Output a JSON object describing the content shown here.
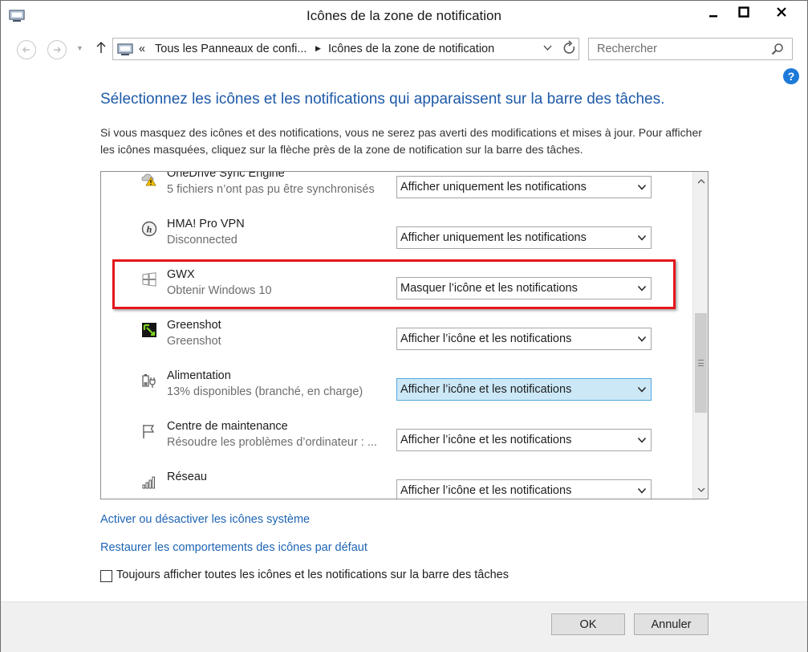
{
  "window": {
    "title": "Icônes de la zone de notification",
    "controls": {
      "minimize": "—",
      "maximize": "□",
      "close": "✕"
    }
  },
  "address": {
    "overflow": "«",
    "crumbs": [
      "Tous les Panneaux de confi...",
      "Icônes de la zone de notification"
    ],
    "search_placeholder": "Rechercher"
  },
  "main": {
    "heading": "Sélectionnez les icônes et les notifications qui apparaissent sur la barre des tâches.",
    "description": "Si vous masquez des icônes et des notifications, vous ne serez pas averti des modifications et mises à jour. Pour afficher les icônes masquées, cliquez sur la flèche près de la zone de notification sur la barre des tâches.",
    "help": "?"
  },
  "rows": [
    {
      "name": "OneDrive Sync Engine",
      "sub": "5 fichiers n’ont pas pu être synchronisés",
      "behavior": "Afficher uniquement les notifications",
      "icon": "onedrive-warning-icon"
    },
    {
      "name": "HMA! Pro VPN",
      "sub": "Disconnected",
      "behavior": "Afficher uniquement les notifications",
      "icon": "hma-vpn-icon"
    },
    {
      "name": "GWX",
      "sub": "Obtenir Windows 10",
      "behavior": "Masquer l’icône et les notifications",
      "icon": "windows-logo-icon"
    },
    {
      "name": "Greenshot",
      "sub": "Greenshot",
      "behavior": "Afficher l’icône et les notifications",
      "icon": "greenshot-icon"
    },
    {
      "name": "Alimentation",
      "sub": "13% disponibles (branché, en charge)",
      "behavior": "Afficher l’icône et les notifications",
      "icon": "battery-plug-icon"
    },
    {
      "name": "Centre de maintenance",
      "sub": "Résoudre les problèmes d’ordinateur : ...",
      "behavior": "Afficher l’icône et les notifications",
      "icon": "flag-icon"
    },
    {
      "name": "Réseau",
      "sub": "",
      "behavior": "Afficher l’icône et les notifications",
      "icon": "network-signal-icon"
    }
  ],
  "links": {
    "system_icons": "Activer ou désactiver les icônes système",
    "restore": "Restaurer les comportements des icônes par défaut"
  },
  "always_show": {
    "label": "Toujours afficher toutes les icônes et les notifications sur la barre des tâches",
    "checked": false
  },
  "buttons": {
    "ok": "OK",
    "cancel": "Annuler"
  },
  "colors": {
    "heading": "#1e5aa8",
    "link": "#1e64b4",
    "highlight_border": "#e3161b",
    "hovered_select": "#cce8f7"
  }
}
